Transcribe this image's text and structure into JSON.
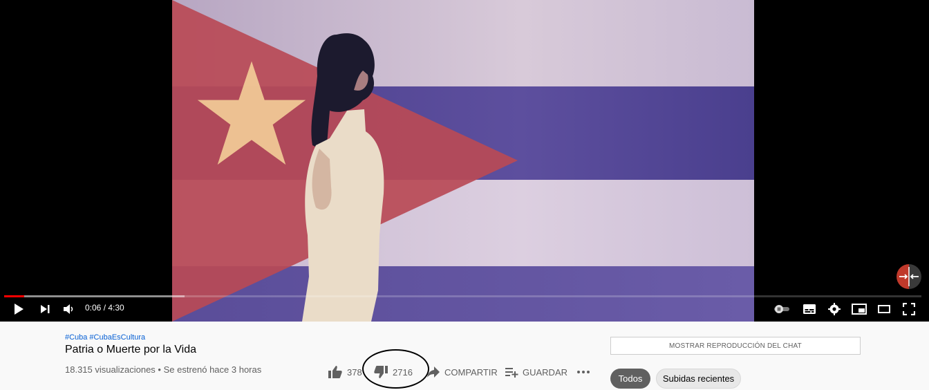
{
  "player": {
    "time_display": "0:06 / 4:30",
    "progress_fraction": 0.022,
    "buffered_fraction": 0.197,
    "accent_color": "#ff0000"
  },
  "controls": {
    "icons": [
      "play-icon",
      "next-icon",
      "volume-icon",
      "autoplay-toggle-icon",
      "subtitles-icon",
      "settings-icon",
      "miniplayer-icon",
      "theater-icon",
      "fullscreen-icon"
    ]
  },
  "video_info": {
    "hashtags": [
      "#Cuba",
      "#CubaEsCultura"
    ],
    "title": "Patria o Muerte por la Vida",
    "views": "18.315 visualizaciones",
    "premiere": "Se estrenó hace 3 horas"
  },
  "actions": {
    "likes": "378",
    "dislikes": "2716",
    "share_label": "COMPARTIR",
    "save_label": "GUARDAR"
  },
  "sidebar": {
    "chat_replay_label": "MOSTRAR REPRODUCCIÓN DEL CHAT",
    "chips": [
      "Todos",
      "Subidas recientes"
    ]
  }
}
